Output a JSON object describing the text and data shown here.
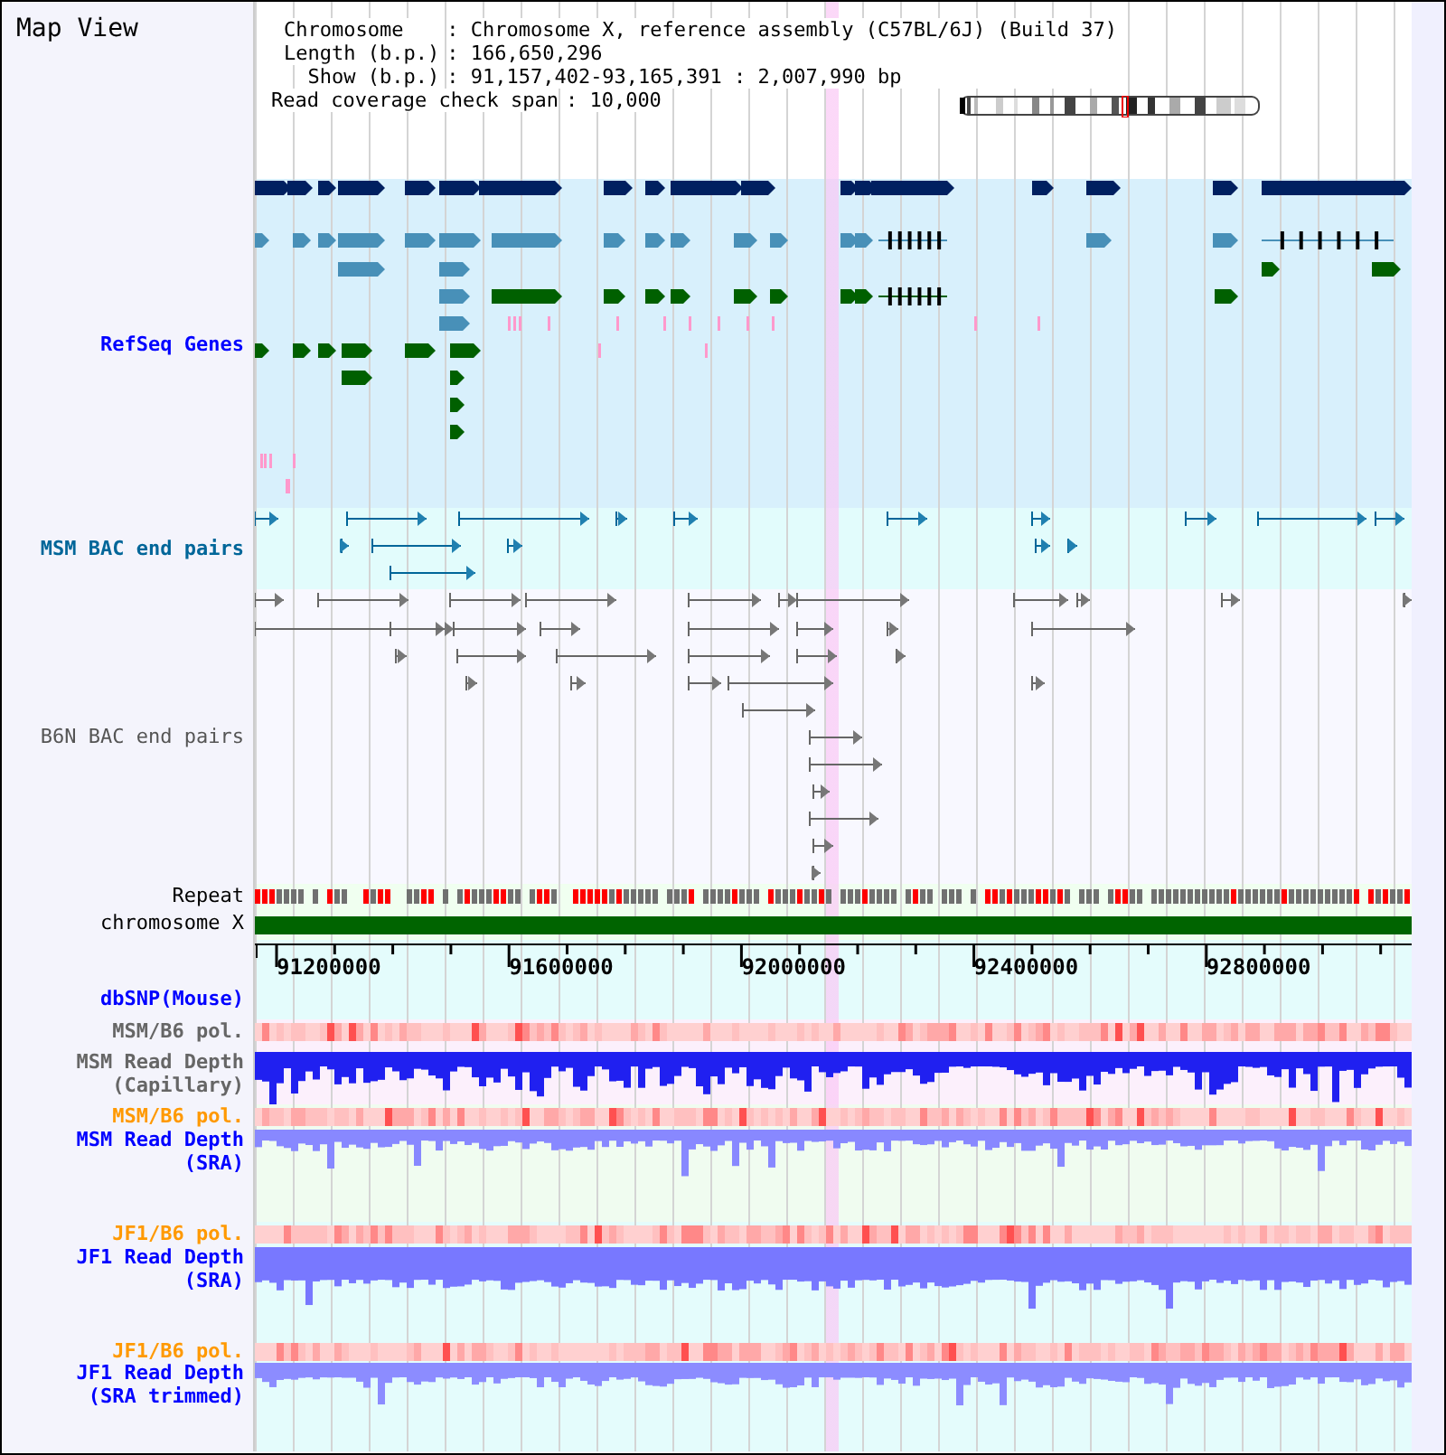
{
  "window": {
    "title": "Map View"
  },
  "info": {
    "lines": [
      {
        "label": "Chromosome",
        "value": ": Chromosome X, reference assembly (C57BL/6J) (Build 37)"
      },
      {
        "label": "Length (b.p.)",
        "value": ": 166,650,296"
      },
      {
        "label": "Show (b.p.)",
        "value": ": 91,157,402-93,165,391 : 2,007,990 bp"
      }
    ],
    "span": {
      "label": "Read coverage check span",
      "value": ": 10,000"
    }
  },
  "tracks": [
    {
      "kind": "genes",
      "label": [
        "RefSeq Genes"
      ],
      "color": "#0000ff"
    },
    {
      "kind": "msm_pairs",
      "label": [
        "MSM BAC end pairs"
      ],
      "color": "#006699"
    },
    {
      "kind": "b6n_pairs",
      "label": [
        "B6N BAC end pairs"
      ],
      "color": "#555555"
    },
    {
      "kind": "repeat",
      "label": [
        "Repeat"
      ],
      "color": "#000000"
    },
    {
      "kind": "chromosome",
      "label": [
        "chromosome X"
      ],
      "color": "#000000"
    },
    {
      "kind": "axis",
      "ticks": [
        "91200000",
        "91600000",
        "92000000",
        "92400000",
        "92800000"
      ]
    },
    {
      "kind": "snp",
      "label": [
        "dbSNP(Mouse)"
      ],
      "color": "#0000ff"
    },
    {
      "kind": "pol",
      "label": [
        "MSM/B6 pol."
      ],
      "color": "#666666"
    },
    {
      "kind": "depth",
      "label": [
        "MSM Read Depth",
        "(Capillary)"
      ],
      "color": "#666666"
    },
    {
      "kind": "pol",
      "label": [
        "MSM/B6 pol."
      ],
      "color": "#ff9900"
    },
    {
      "kind": "depth",
      "label": [
        "MSM Read Depth",
        "(SRA)"
      ],
      "color": "#0000ff"
    },
    {
      "kind": "pol",
      "label": [
        "JF1/B6 pol."
      ],
      "color": "#ff9900"
    },
    {
      "kind": "depth",
      "label": [
        "JF1 Read Depth",
        "(SRA)"
      ],
      "color": "#0000ff"
    },
    {
      "kind": "pol",
      "label": [
        "JF1/B6 pol."
      ],
      "color": "#ff9900"
    },
    {
      "kind": "depth",
      "label": [
        "JF1 Read Depth",
        "(SRA trimmed)"
      ],
      "color": "#0000ff"
    }
  ]
}
